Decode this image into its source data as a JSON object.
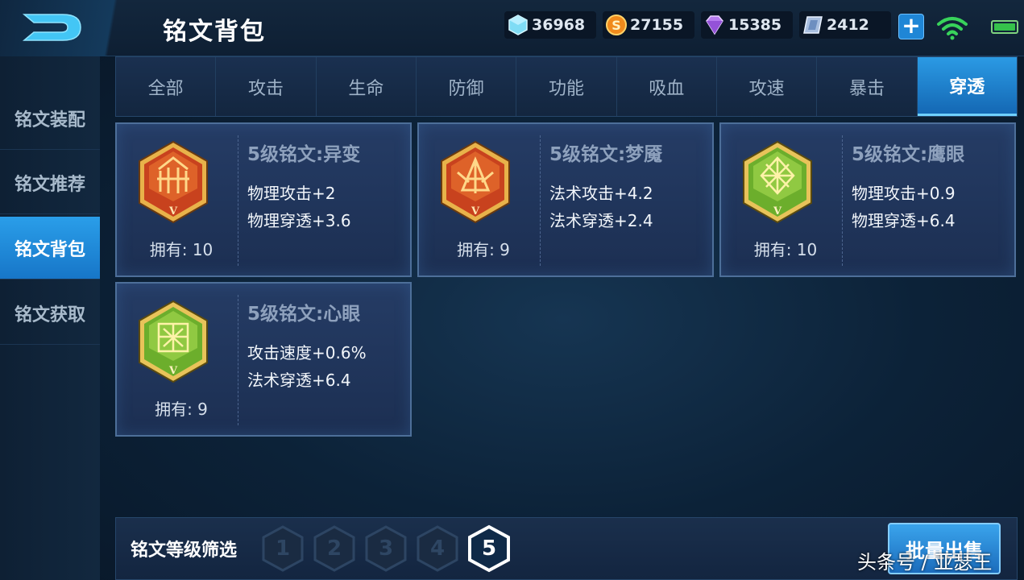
{
  "header": {
    "title": "铭文背包"
  },
  "currencies": [
    {
      "icon": "diamond-icon",
      "value": "36968"
    },
    {
      "icon": "gold-coin-icon",
      "value": "27155"
    },
    {
      "icon": "purple-gem-icon",
      "value": "15385"
    },
    {
      "icon": "coupon-icon",
      "value": "2412"
    }
  ],
  "sidebar": {
    "items": [
      {
        "label": "铭文装配",
        "active": false
      },
      {
        "label": "铭文推荐",
        "active": false
      },
      {
        "label": "铭文背包",
        "active": true
      },
      {
        "label": "铭文获取",
        "active": false
      }
    ]
  },
  "tabs": [
    {
      "label": "全部"
    },
    {
      "label": "攻击"
    },
    {
      "label": "生命"
    },
    {
      "label": "防御"
    },
    {
      "label": "功能"
    },
    {
      "label": "吸血"
    },
    {
      "label": "攻速"
    },
    {
      "label": "暴击"
    },
    {
      "label": "穿透",
      "active": true
    }
  ],
  "cards": [
    {
      "name": "5级铭文:异变",
      "stat1": "物理攻击+2",
      "stat2": "物理穿透+3.6",
      "owned": "拥有: 10",
      "color": "red"
    },
    {
      "name": "5级铭文:梦魇",
      "stat1": "法术攻击+4.2",
      "stat2": "法术穿透+2.4",
      "owned": "拥有: 9",
      "color": "red"
    },
    {
      "name": "5级铭文:鹰眼",
      "stat1": "物理攻击+0.9",
      "stat2": "物理穿透+6.4",
      "owned": "拥有: 10",
      "color": "green"
    },
    {
      "name": "5级铭文:心眼",
      "stat1": "攻击速度+0.6%",
      "stat2": "法术穿透+6.4",
      "owned": "拥有: 9",
      "color": "green"
    }
  ],
  "emblem_tier": "V",
  "filter": {
    "label": "铭文等级筛选",
    "levels": [
      "1",
      "2",
      "3",
      "4",
      "5"
    ],
    "selected": "5"
  },
  "batch_sell_label": "批量出售",
  "watermark": "头条号 / 亚瑟王",
  "colors": {
    "accent": "#2b9ae4",
    "red_emblem": "#c8421e",
    "green_emblem": "#6cae2c",
    "gold_frame": "#e8b24a"
  }
}
